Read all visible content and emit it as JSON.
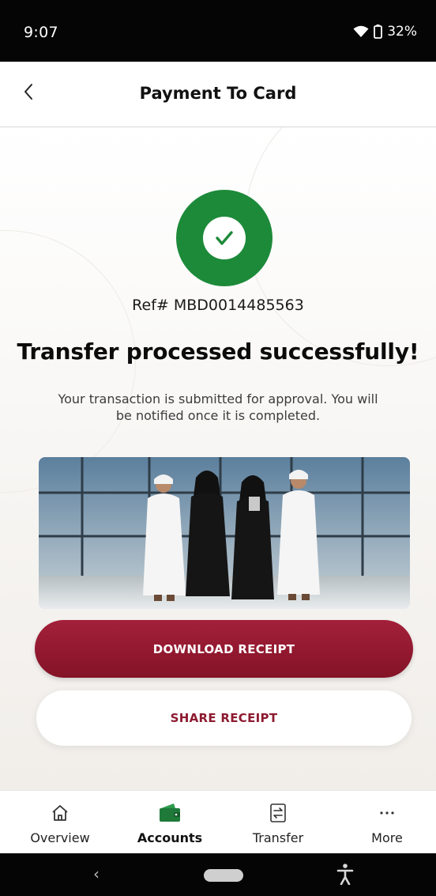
{
  "status_bar": {
    "time": "9:07",
    "battery": "32%"
  },
  "header": {
    "title": "Payment To Card",
    "back_icon": "chevron-left-icon"
  },
  "success": {
    "icon": "checkmark-icon",
    "color": "#1d8a3a",
    "reference": "Ref# MBD0014485563",
    "headline": "Transfer processed successfully!",
    "message": "Your transaction is submitted for approval. You will be notified once it is completed."
  },
  "actions": {
    "download_label": "DOWNLOAD RECEIPT",
    "share_label": "SHARE RECEIPT",
    "primary_color": "#9a1b34"
  },
  "tabs": [
    {
      "label": "Overview",
      "icon": "home-icon",
      "active": false
    },
    {
      "label": "Accounts",
      "icon": "wallet-icon",
      "active": true
    },
    {
      "label": "Transfer",
      "icon": "transfer-icon",
      "active": false
    },
    {
      "label": "More",
      "icon": "more-icon",
      "active": false
    }
  ],
  "system_nav": {
    "back": "‹"
  }
}
